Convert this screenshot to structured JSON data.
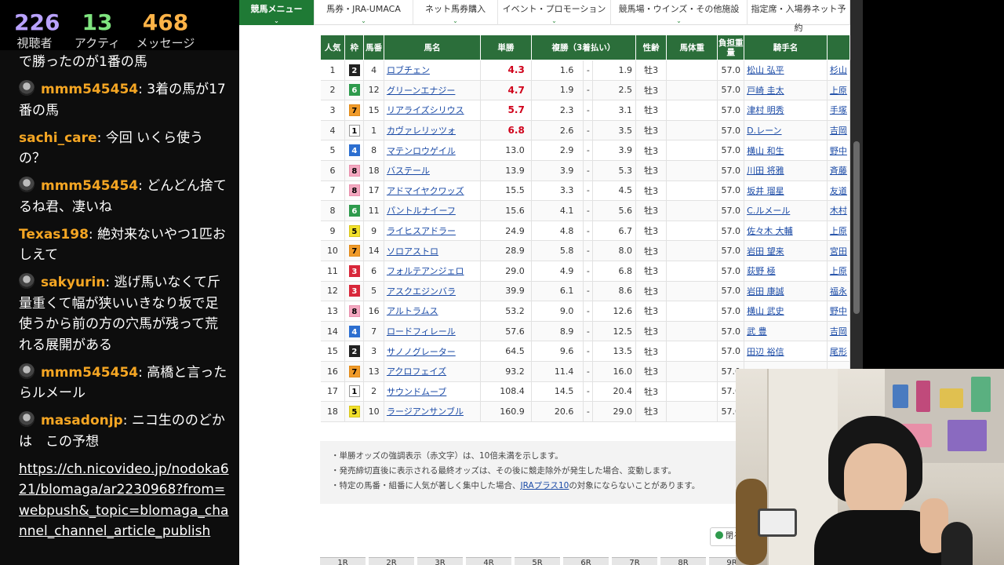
{
  "stats": {
    "viewers": {
      "value": "226",
      "label": "視聴者"
    },
    "active": {
      "value": "13",
      "label": "アクティブ"
    },
    "messages": {
      "value": "468",
      "label": "メッセージ"
    }
  },
  "chat": {
    "top_fragment": "で勝ったのが1番の馬",
    "messages": [
      {
        "user": "mmm545454",
        "text": "3着の馬が17番の馬",
        "avatar": true
      },
      {
        "user": "sachi_care",
        "text": "今回 いくら使うの？",
        "avatar": false
      },
      {
        "user": "mmm545454",
        "text": "どんどん捨てるね君、凄いね",
        "avatar": true
      },
      {
        "user": "Texas198",
        "text": "絶対来ないやつ1匹おしえて",
        "avatar": false
      },
      {
        "user": "sakyurin",
        "text": "逃げ馬いなくて斤量重くて幅が狭いいきなり坂で足使うから前の方の穴馬が残って荒れる展開がある",
        "avatar": true
      },
      {
        "user": "mmm545454",
        "text": "高橋と言ったらルメール",
        "avatar": true
      },
      {
        "user": "masadonjp",
        "text": "ニコ生ののどかは　この予想",
        "avatar": true
      }
    ],
    "link": "https://ch.nicovideo.jp/nodoka621/blomaga/ar2230968?from=webpush&_topic=blomaga_channel_channel_article_publish"
  },
  "nav": {
    "items": [
      "競馬メニュー",
      "馬券・JRA-UMACA",
      "ネット馬券購入",
      "イベント・プロモーション",
      "競馬場・ウインズ・その他施設",
      "指定席・入場券ネット予約"
    ]
  },
  "table": {
    "headers": {
      "popularity": "人気",
      "frame": "枠",
      "number": "馬番",
      "name": "馬名",
      "win": "単勝",
      "place": "複勝（3着払い）",
      "sex_age": "性齢",
      "weight": "馬体重",
      "load": "負担重量",
      "jockey": "騎手名",
      "trainer": ""
    },
    "rows": [
      {
        "pop": "1",
        "frame": "2",
        "num": "4",
        "name": "ロブチェン",
        "win": "4.3",
        "hot": true,
        "plo": "1.6",
        "phi": "1.9",
        "sex": "牡3",
        "load": "57.0",
        "jockey": "松山 弘平",
        "trainer": "杉山"
      },
      {
        "pop": "2",
        "frame": "6",
        "num": "12",
        "name": "グリーンエナジー",
        "win": "4.7",
        "hot": true,
        "plo": "1.9",
        "phi": "2.5",
        "sex": "牡3",
        "load": "57.0",
        "jockey": "戸崎 圭太",
        "trainer": "上原"
      },
      {
        "pop": "3",
        "frame": "7",
        "num": "15",
        "name": "リアライズシリウス",
        "win": "5.7",
        "hot": true,
        "plo": "2.3",
        "phi": "3.1",
        "sex": "牡3",
        "load": "57.0",
        "jockey": "津村 明秀",
        "trainer": "手塚"
      },
      {
        "pop": "4",
        "frame": "1",
        "num": "1",
        "name": "カヴァレリッツォ",
        "win": "6.8",
        "hot": true,
        "plo": "2.6",
        "phi": "3.5",
        "sex": "牡3",
        "load": "57.0",
        "jockey": "D.レーン",
        "trainer": "吉岡"
      },
      {
        "pop": "5",
        "frame": "4",
        "num": "8",
        "name": "マテンロウゲイル",
        "win": "13.0",
        "hot": false,
        "plo": "2.9",
        "phi": "3.9",
        "sex": "牡3",
        "load": "57.0",
        "jockey": "横山 和生",
        "trainer": "野中"
      },
      {
        "pop": "6",
        "frame": "8",
        "num": "18",
        "name": "バステール",
        "win": "13.9",
        "hot": false,
        "plo": "3.9",
        "phi": "5.3",
        "sex": "牡3",
        "load": "57.0",
        "jockey": "川田 将雅",
        "trainer": "斉藤"
      },
      {
        "pop": "7",
        "frame": "8",
        "num": "17",
        "name": "アドマイヤクワッズ",
        "win": "15.5",
        "hot": false,
        "plo": "3.3",
        "phi": "4.5",
        "sex": "牡3",
        "load": "57.0",
        "jockey": "坂井 瑠星",
        "trainer": "友道"
      },
      {
        "pop": "8",
        "frame": "6",
        "num": "11",
        "name": "パントルナイーフ",
        "win": "15.6",
        "hot": false,
        "plo": "4.1",
        "phi": "5.6",
        "sex": "牡3",
        "load": "57.0",
        "jockey": "C.ルメール",
        "trainer": "木村"
      },
      {
        "pop": "9",
        "frame": "5",
        "num": "9",
        "name": "ライヒスアドラー",
        "win": "24.9",
        "hot": false,
        "plo": "4.8",
        "phi": "6.7",
        "sex": "牡3",
        "load": "57.0",
        "jockey": "佐々木 大輔",
        "trainer": "上原"
      },
      {
        "pop": "10",
        "frame": "7",
        "num": "14",
        "name": "ソロアストロ",
        "win": "28.9",
        "hot": false,
        "plo": "5.8",
        "phi": "8.0",
        "sex": "牡3",
        "load": "57.0",
        "jockey": "岩田 望来",
        "trainer": "宮田"
      },
      {
        "pop": "11",
        "frame": "3",
        "num": "6",
        "name": "フォルテアンジェロ",
        "win": "29.0",
        "hot": false,
        "plo": "4.9",
        "phi": "6.8",
        "sex": "牡3",
        "load": "57.0",
        "jockey": "荻野 極",
        "trainer": "上原"
      },
      {
        "pop": "12",
        "frame": "3",
        "num": "5",
        "name": "アスクエジンバラ",
        "win": "39.9",
        "hot": false,
        "plo": "6.1",
        "phi": "8.6",
        "sex": "牡3",
        "load": "57.0",
        "jockey": "岩田 康誠",
        "trainer": "福永"
      },
      {
        "pop": "13",
        "frame": "8",
        "num": "16",
        "name": "アルトラムス",
        "win": "53.2",
        "hot": false,
        "plo": "9.0",
        "phi": "12.6",
        "sex": "牡3",
        "load": "57.0",
        "jockey": "横山 武史",
        "trainer": "野中"
      },
      {
        "pop": "14",
        "frame": "4",
        "num": "7",
        "name": "ロードフィレール",
        "win": "57.6",
        "hot": false,
        "plo": "8.9",
        "phi": "12.5",
        "sex": "牡3",
        "load": "57.0",
        "jockey": "武 豊",
        "trainer": "吉岡"
      },
      {
        "pop": "15",
        "frame": "2",
        "num": "3",
        "name": "サノノグレーター",
        "win": "64.5",
        "hot": false,
        "plo": "9.6",
        "phi": "13.5",
        "sex": "牡3",
        "load": "57.0",
        "jockey": "田辺 裕信",
        "trainer": "尾形"
      },
      {
        "pop": "16",
        "frame": "7",
        "num": "13",
        "name": "アクロフェイズ",
        "win": "93.2",
        "hot": false,
        "plo": "11.4",
        "phi": "16.0",
        "sex": "牡3",
        "load": "57.0",
        "jockey": "",
        "trainer": ""
      },
      {
        "pop": "17",
        "frame": "1",
        "num": "2",
        "name": "サウンドムーブ",
        "win": "108.4",
        "hot": false,
        "plo": "14.5",
        "phi": "20.4",
        "sex": "牡3",
        "load": "57.0",
        "jockey": "",
        "trainer": ""
      },
      {
        "pop": "18",
        "frame": "5",
        "num": "10",
        "name": "ラージアンサンブル",
        "win": "160.9",
        "hot": false,
        "plo": "20.6",
        "phi": "29.0",
        "sex": "牡3",
        "load": "57.0",
        "jockey": "",
        "trainer": ""
      }
    ],
    "dash": "-"
  },
  "notes": {
    "n1": "単勝オッズの強調表示（赤文字）は、10倍未満を示します。",
    "n2": "発売締切直後に表示される最終オッズは、その後に競走除外が発生した場合、変動します。",
    "n3_pre": "特定の馬番・組番に人気が著しく集中した場合、",
    "n3_link": "JRAプラス10",
    "n3_post": "の対象にならないことがあります。"
  },
  "close_button": "閉るる",
  "race_tabs": [
    "1R",
    "2R",
    "3R",
    "4R",
    "5R",
    "6R",
    "7R",
    "8R",
    "9R"
  ],
  "colors": {
    "nav_active": "#1f7a35",
    "header_green": "#2b6e3a",
    "hot_odds": "#d0021b",
    "link": "#1a4aa6"
  }
}
